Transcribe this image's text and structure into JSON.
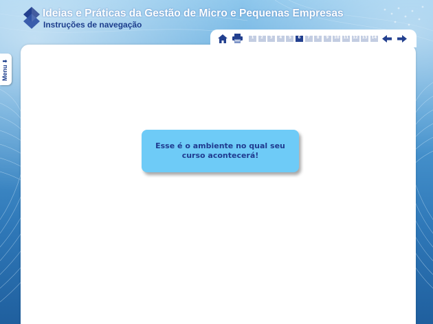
{
  "header": {
    "title": "Ideias e Práticas da Gestão de Micro e Pequenas Empresas",
    "subtitle": "Instruções de navegação"
  },
  "nav": {
    "home_icon": "home-icon",
    "print_icon": "print-icon",
    "pages": [
      "1",
      "2",
      "3",
      "4",
      "5",
      "6",
      "7",
      "8",
      "9",
      "10",
      "11",
      "12",
      "13",
      "14"
    ],
    "current_page": "6",
    "prev_icon": "arrow-left-icon",
    "next_icon": "arrow-right-icon"
  },
  "menu": {
    "label": "Menu"
  },
  "callout": {
    "text": "Esse é o ambiente no qual seu curso acontecerá!"
  },
  "colors": {
    "accent": "#23408f",
    "callout_bg": "#6ecbf7",
    "page_inactive": "#c3cde2",
    "background": "#4f9cd4"
  }
}
